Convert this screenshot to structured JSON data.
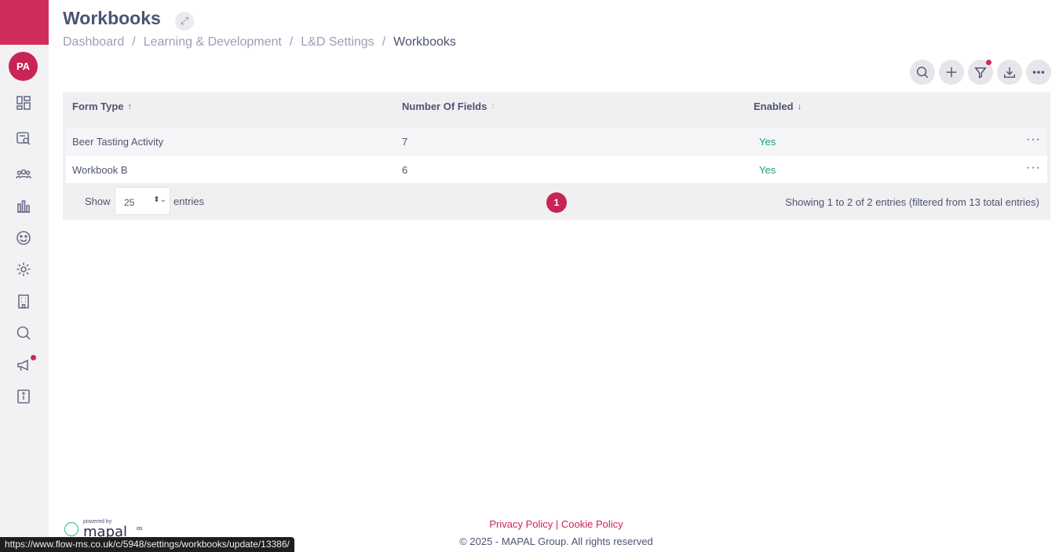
{
  "sidebar": {
    "avatar_initials": "PA",
    "items": [
      {
        "icon": "dashboard-icon"
      },
      {
        "icon": "search-form-icon"
      },
      {
        "icon": "people-icon"
      },
      {
        "icon": "bar-chart-icon"
      },
      {
        "icon": "smiley-icon"
      },
      {
        "icon": "gear-icon"
      },
      {
        "icon": "building-icon"
      },
      {
        "icon": "search-icon"
      },
      {
        "icon": "megaphone-icon"
      },
      {
        "icon": "info-icon"
      }
    ]
  },
  "header": {
    "title": "Workbooks",
    "expand_glyph": "⤢",
    "breadcrumb": [
      "Dashboard",
      "Learning & Development",
      "L&D Settings",
      "Workbooks"
    ],
    "separator": "/"
  },
  "toolbar": {
    "buttons": [
      "search-icon",
      "plus-icon",
      "filter-icon",
      "download-icon",
      "more-icon"
    ],
    "filter_has_notification": true
  },
  "table": {
    "columns": [
      {
        "label": "Form Type",
        "sort": "asc",
        "glyph": "↑"
      },
      {
        "label": "Number Of Fields",
        "sort": "none",
        "glyph": "↕"
      },
      {
        "label": "Enabled",
        "sort": "desc",
        "glyph": "↓"
      }
    ],
    "rows": [
      {
        "form_type": "Beer Tasting Activity",
        "fields": "7",
        "enabled": "Yes",
        "menu": "···"
      },
      {
        "form_type": "Workbook B",
        "fields": "6",
        "enabled": "Yes",
        "menu": "···"
      }
    ],
    "show_label": "Show",
    "page_size": "25",
    "entries_label": "entries",
    "current_page": "1",
    "summary": "Showing 1 to 2 of 2 entries (filtered from 13 total entries)"
  },
  "footer": {
    "powered_by": "powered by",
    "logo_text": "mapal",
    "logo_suffix": "os",
    "policy_links": "Privacy Policy | Cookie Policy",
    "copyright": "© 2025 - MAPAL Group. All rights reserved"
  },
  "status_url": "https://www.flow-ms.co.uk/c/5948/settings/workbooks/update/13386/",
  "colors": {
    "brand": "#cf2e5d",
    "accent": "#c72556",
    "success": "#1aa37a",
    "text": "#4d5472"
  }
}
